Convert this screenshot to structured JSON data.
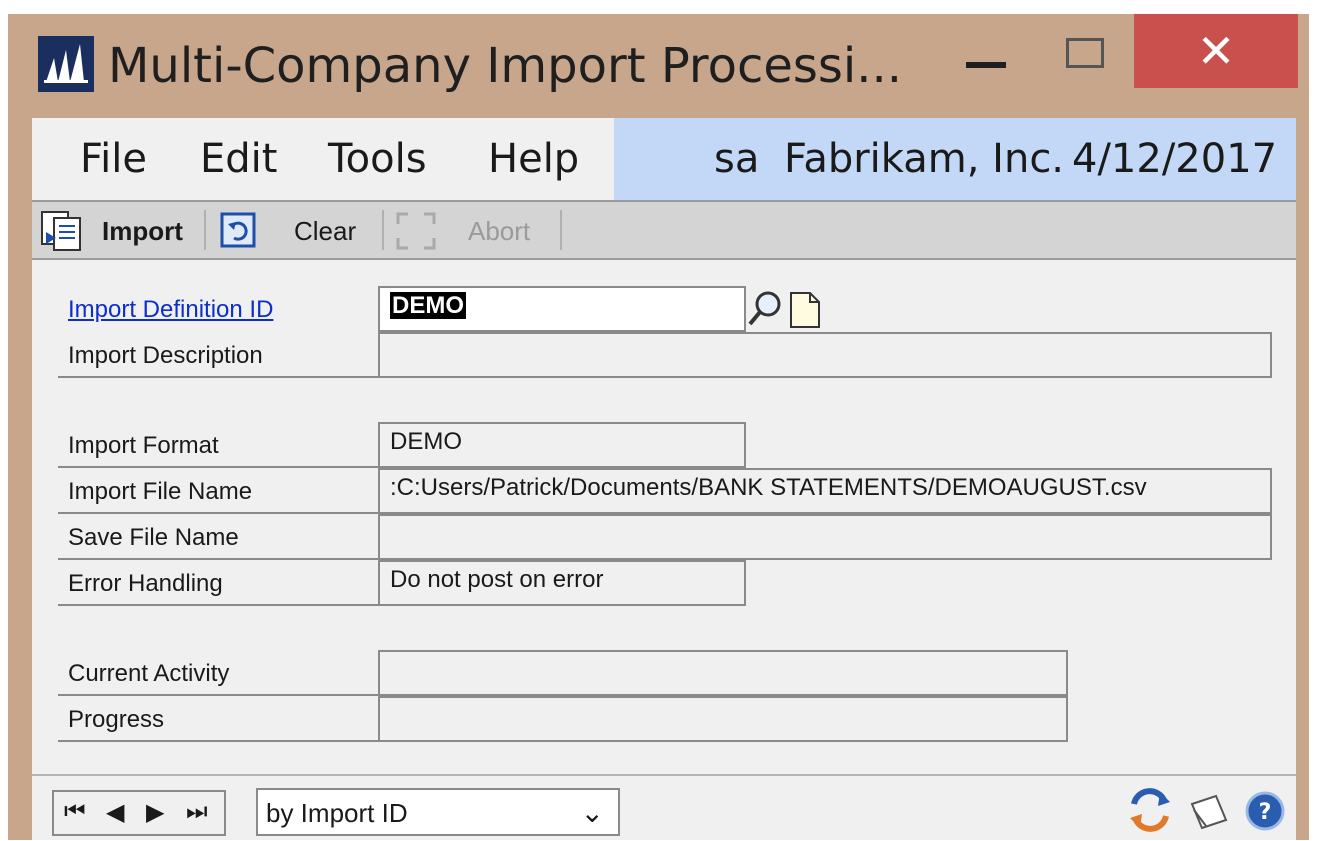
{
  "window": {
    "title": "Multi-Company Import Processi...",
    "minimize_symbol": "—",
    "close_symbol": "✕"
  },
  "menu": {
    "items": [
      "File",
      "Edit",
      "Tools",
      "Help"
    ]
  },
  "user_info": {
    "user": "sa",
    "company": "Fabrikam, Inc.",
    "date": "4/12/2017",
    "background": "#c3d8f7"
  },
  "toolbar": {
    "import_label": "Import",
    "clear_label": "Clear",
    "abort_label": "Abort"
  },
  "form": {
    "import_definition_id": {
      "label": "Import Definition ID",
      "value": "DEMO"
    },
    "import_description": {
      "label": "Import Description",
      "value": ""
    },
    "import_format": {
      "label": "Import Format",
      "value": "DEMO"
    },
    "import_file_name": {
      "label": "Import File Name",
      "value": ":C:Users/Patrick/Documents/BANK STATEMENTS/DEMOAUGUST.csv"
    },
    "save_file_name": {
      "label": "Save File Name",
      "value": ""
    },
    "error_handling": {
      "label": "Error Handling",
      "value": "Do not post on error"
    },
    "current_activity": {
      "label": "Current Activity",
      "value": ""
    },
    "progress": {
      "label": "Progress",
      "value": ""
    }
  },
  "footer": {
    "sort_by": "by Import ID"
  },
  "colors": {
    "frame": "#c7a68c",
    "close_button": "#c9504d",
    "link": "#0b2ecc"
  }
}
